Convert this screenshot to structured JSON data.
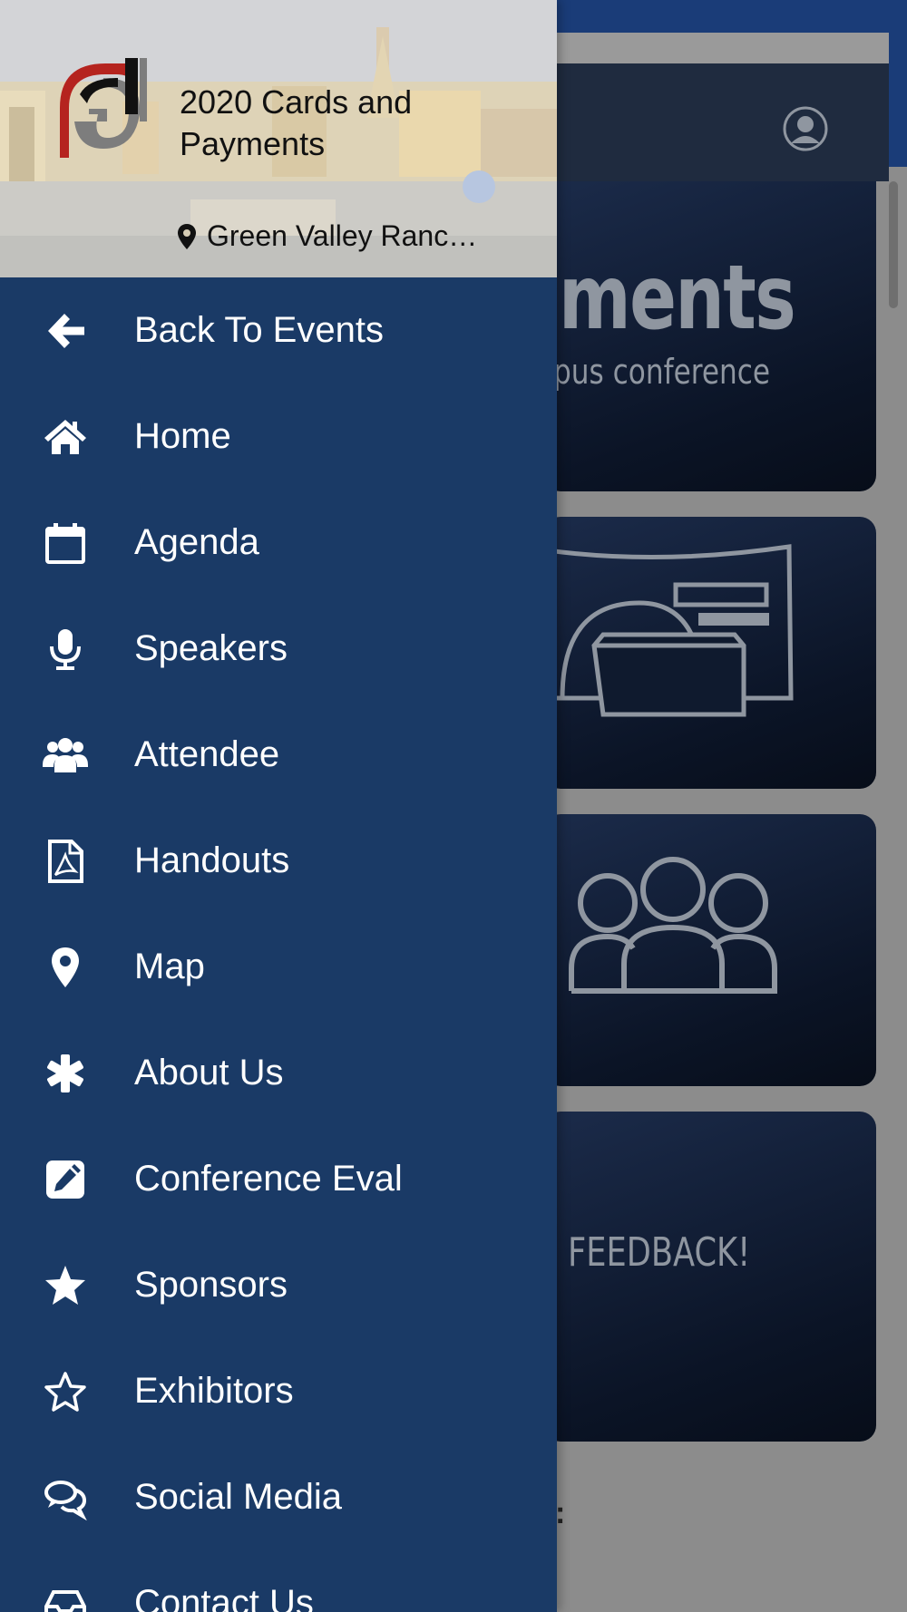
{
  "event": {
    "title": "2020 Cards and Payments",
    "location": "Green Valley Ranc…"
  },
  "menu": {
    "items": [
      {
        "label": "Back To Events",
        "icon": "arrow-left-icon"
      },
      {
        "label": "Home",
        "icon": "home-icon"
      },
      {
        "label": "Agenda",
        "icon": "calendar-icon"
      },
      {
        "label": "Speakers",
        "icon": "microphone-icon"
      },
      {
        "label": "Attendee",
        "icon": "users-icon"
      },
      {
        "label": "Handouts",
        "icon": "pdf-file-icon"
      },
      {
        "label": "Map",
        "icon": "map-pin-icon"
      },
      {
        "label": "About Us",
        "icon": "asterisk-icon"
      },
      {
        "label": "Conference Eval",
        "icon": "edit-icon"
      },
      {
        "label": "Sponsors",
        "icon": "star-filled-icon"
      },
      {
        "label": "Exhibitors",
        "icon": "star-outline-icon"
      },
      {
        "label": "Social Media",
        "icon": "chat-bubbles-icon"
      },
      {
        "label": "Contact Us",
        "icon": "contact-icon"
      }
    ]
  },
  "background": {
    "card1_title": "ments",
    "card1_subtitle": "pus conference",
    "card4_text": "FEEDBACK!",
    "footer_fragment": ":"
  },
  "colors": {
    "drawer_bg": "#1a3a66",
    "topbar": "#1a3c78",
    "card_dark": "#0b1426",
    "text_white": "#ffffff"
  }
}
